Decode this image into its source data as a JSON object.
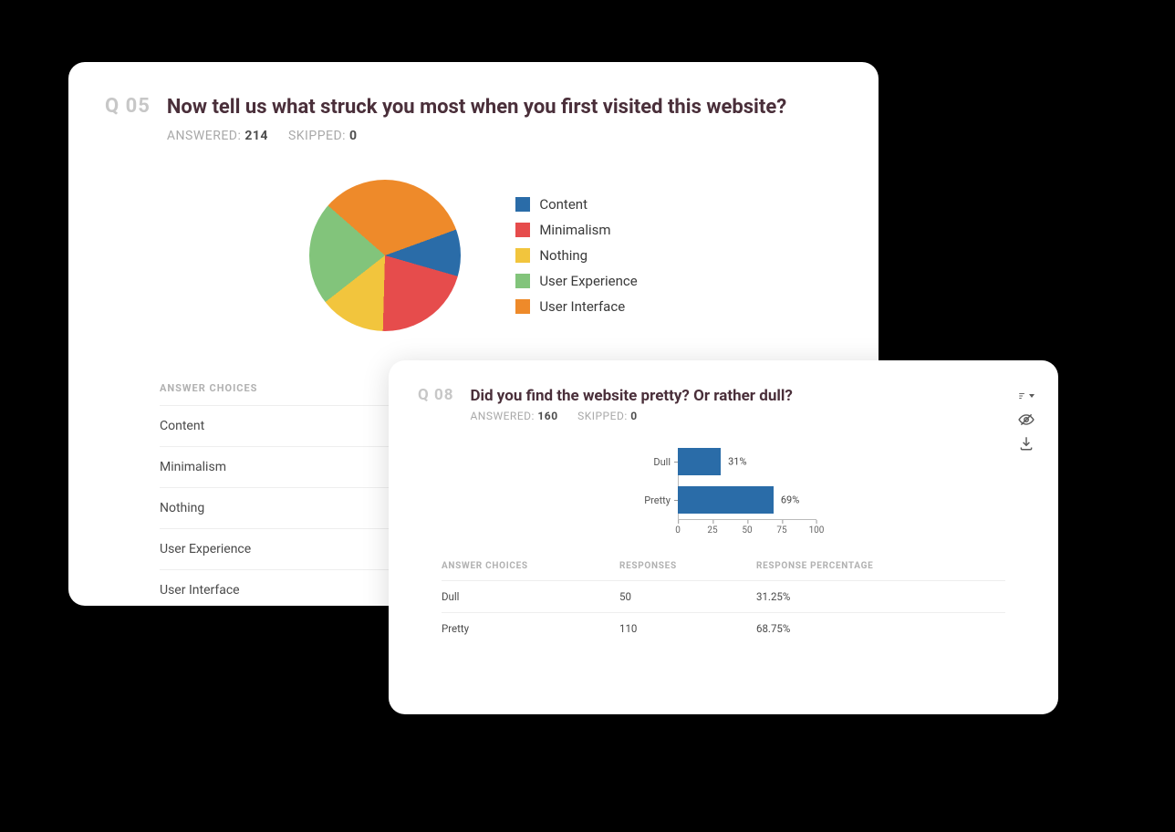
{
  "colors": {
    "blue": "#2a6ca8",
    "red": "#e64c4c",
    "yellow": "#f2c53d",
    "green": "#82c47b",
    "orange": "#ee8a2a"
  },
  "q1": {
    "qnum": "Q 05",
    "title": "Now tell us what struck you most when you first visited this website?",
    "answered_label": "ANSWERED:",
    "answered": "214",
    "skipped_label": "SKIPPED:",
    "skipped": "0",
    "choices_header": "ANSWER CHOICES",
    "legend": [
      {
        "label": "Content",
        "color": "blue"
      },
      {
        "label": "Minimalism",
        "color": "red"
      },
      {
        "label": "Nothing",
        "color": "yellow"
      },
      {
        "label": "User Experience",
        "color": "green"
      },
      {
        "label": "User Interface",
        "color": "orange"
      }
    ],
    "choices": [
      "Content",
      "Minimalism",
      "Nothing",
      "Nothing",
      "User Experience",
      "User Interface"
    ]
  },
  "q2": {
    "qnum": "Q 08",
    "title": "Did you find the website pretty? Or rather dull?",
    "answered_label": "ANSWERED:",
    "answered": "160",
    "skipped_label": "SKIPPED:",
    "skipped": "0",
    "table_headers": {
      "a": "ANSWER CHOICES",
      "b": "RESPONSES",
      "c": "RESPONSE PERCENTAGE"
    },
    "rows": [
      {
        "choice": "Dull",
        "responses": "50",
        "pct": "31.25%"
      },
      {
        "choice": "Pretty",
        "responses": "110",
        "pct": "68.75%"
      }
    ]
  },
  "chart_data": [
    {
      "type": "pie",
      "title": "Now tell us what struck you most when you first visited this website?",
      "series": [
        {
          "name": "Content",
          "value": 10,
          "color": "#2a6ca8"
        },
        {
          "name": "Minimalism",
          "value": 21,
          "color": "#e64c4c"
        },
        {
          "name": "Nothing",
          "value": 14,
          "color": "#f2c53d"
        },
        {
          "name": "User Experience",
          "value": 22,
          "color": "#82c47b"
        },
        {
          "name": "User Interface",
          "value": 33,
          "color": "#ee8a2a"
        }
      ]
    },
    {
      "type": "bar",
      "orientation": "horizontal",
      "title": "Did you find the website pretty? Or rather dull?",
      "xlabel": "",
      "ylabel": "",
      "xlim": [
        0,
        100
      ],
      "ticks": [
        0,
        25,
        50,
        75,
        100
      ],
      "categories": [
        "Dull",
        "Pretty"
      ],
      "values": [
        31,
        69
      ],
      "value_labels": [
        "31%",
        "69%"
      ],
      "color": "#2a6ca8"
    }
  ]
}
